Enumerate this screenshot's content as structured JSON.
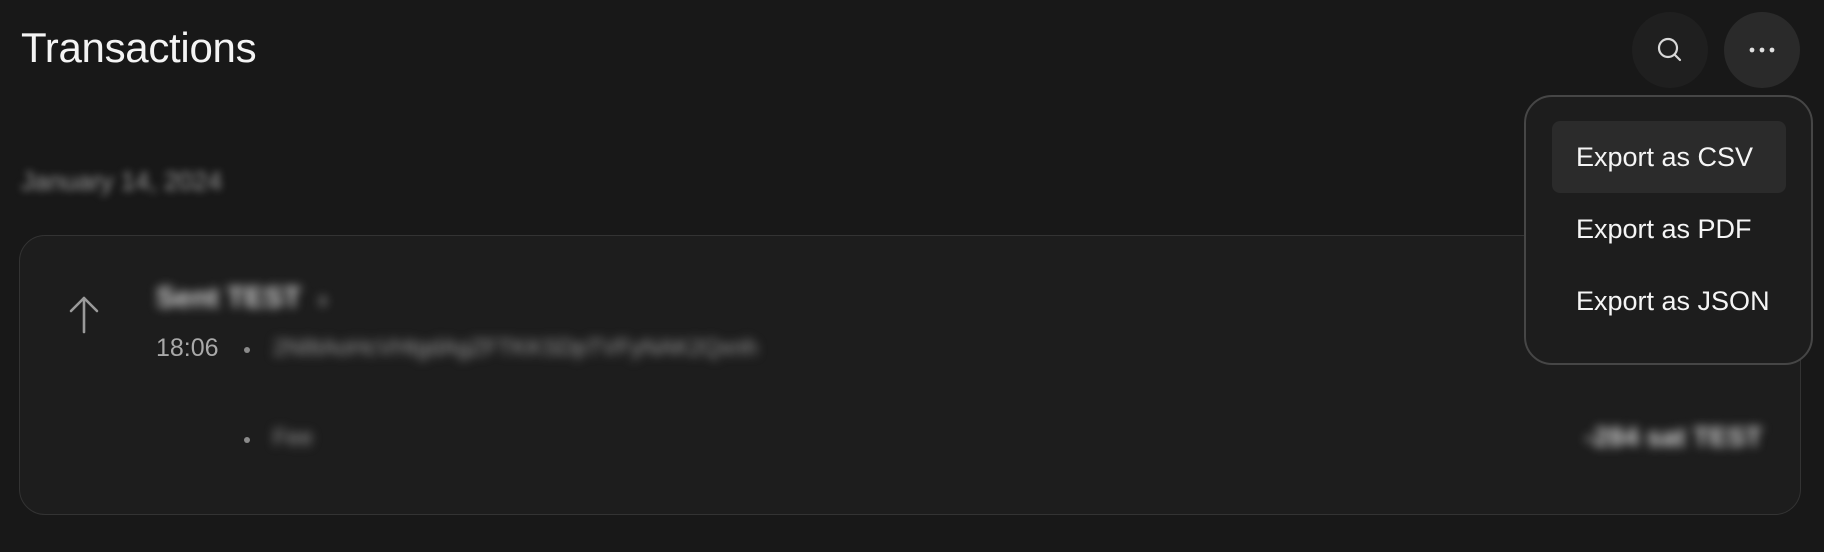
{
  "header": {
    "title": "Transactions"
  },
  "icons": {
    "search": "search-icon",
    "more": "more-horizontal-icon",
    "arrow": "arrow-up-icon",
    "chevron": "chevron-right-icon"
  },
  "transactions": {
    "date_label": "January 14, 2024",
    "items": [
      {
        "name": "Sent TEST",
        "time": "18:06",
        "address": "2N8tAoHcVHtgdAgZFTKKSDpTVFyNAK2Qxnh",
        "fee_label": "Fee",
        "amount": "",
        "fee_amount": "-284 sat TEST"
      }
    ]
  },
  "menu": {
    "items": [
      {
        "label": "Export as CSV",
        "highlighted": true
      },
      {
        "label": "Export as PDF",
        "highlighted": false
      },
      {
        "label": "Export as JSON",
        "highlighted": false
      }
    ]
  },
  "colors": {
    "background": "#181818",
    "card": "#1d1d1d",
    "menu_border": "#464646",
    "highlight": "#2b2b2b"
  }
}
